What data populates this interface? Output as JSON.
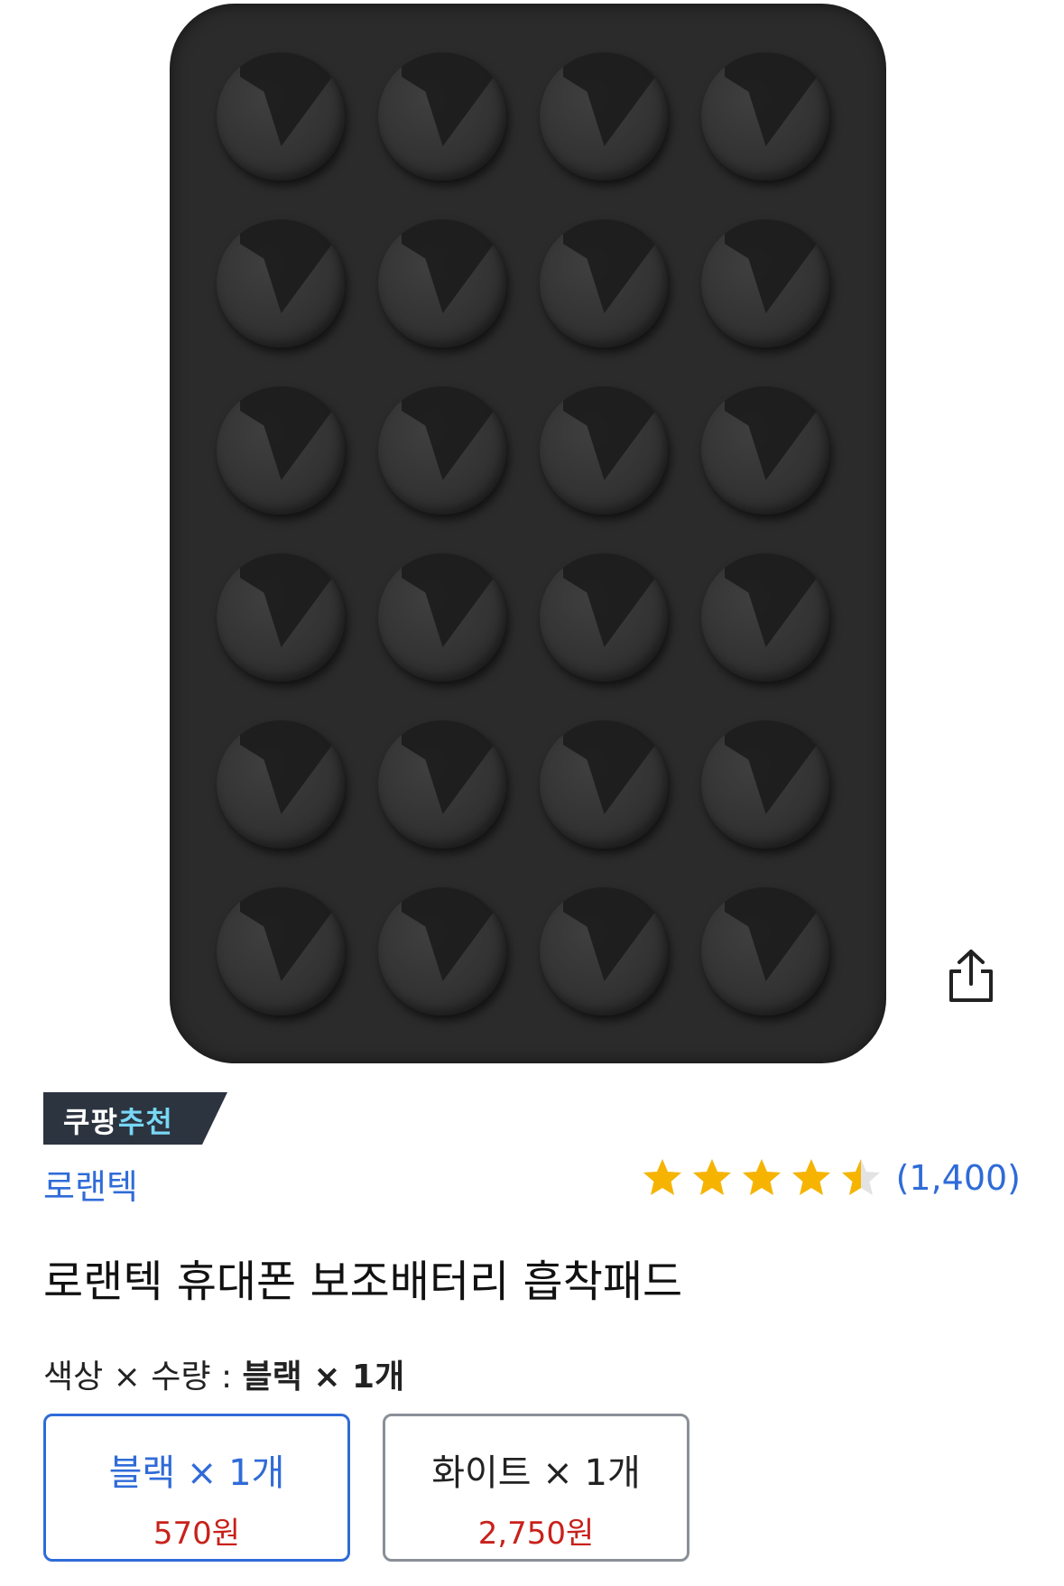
{
  "product": {
    "badge": {
      "part1": "쿠팡",
      "part2": "추천"
    },
    "brand": "로랜텍",
    "rating": {
      "stars": 4.5,
      "max": 5,
      "reviews_text": "(1,400)"
    },
    "title": "로랜텍 휴대폰 보조배터리 흡착패드"
  },
  "selection": {
    "label": "색상 × 수량 : ",
    "value": "블랙 × 1개"
  },
  "options": [
    {
      "name": "블랙 × 1개",
      "price": "570원",
      "selected": true
    },
    {
      "name": "화이트 × 1개",
      "price": "2,750원",
      "selected": false
    }
  ],
  "icons": {
    "share": "share-icon",
    "star": "star-icon"
  },
  "colors": {
    "accent": "#2f6bd8",
    "price": "#c8211b",
    "star": "#f6b400",
    "badge_bg": "#2c3440"
  }
}
